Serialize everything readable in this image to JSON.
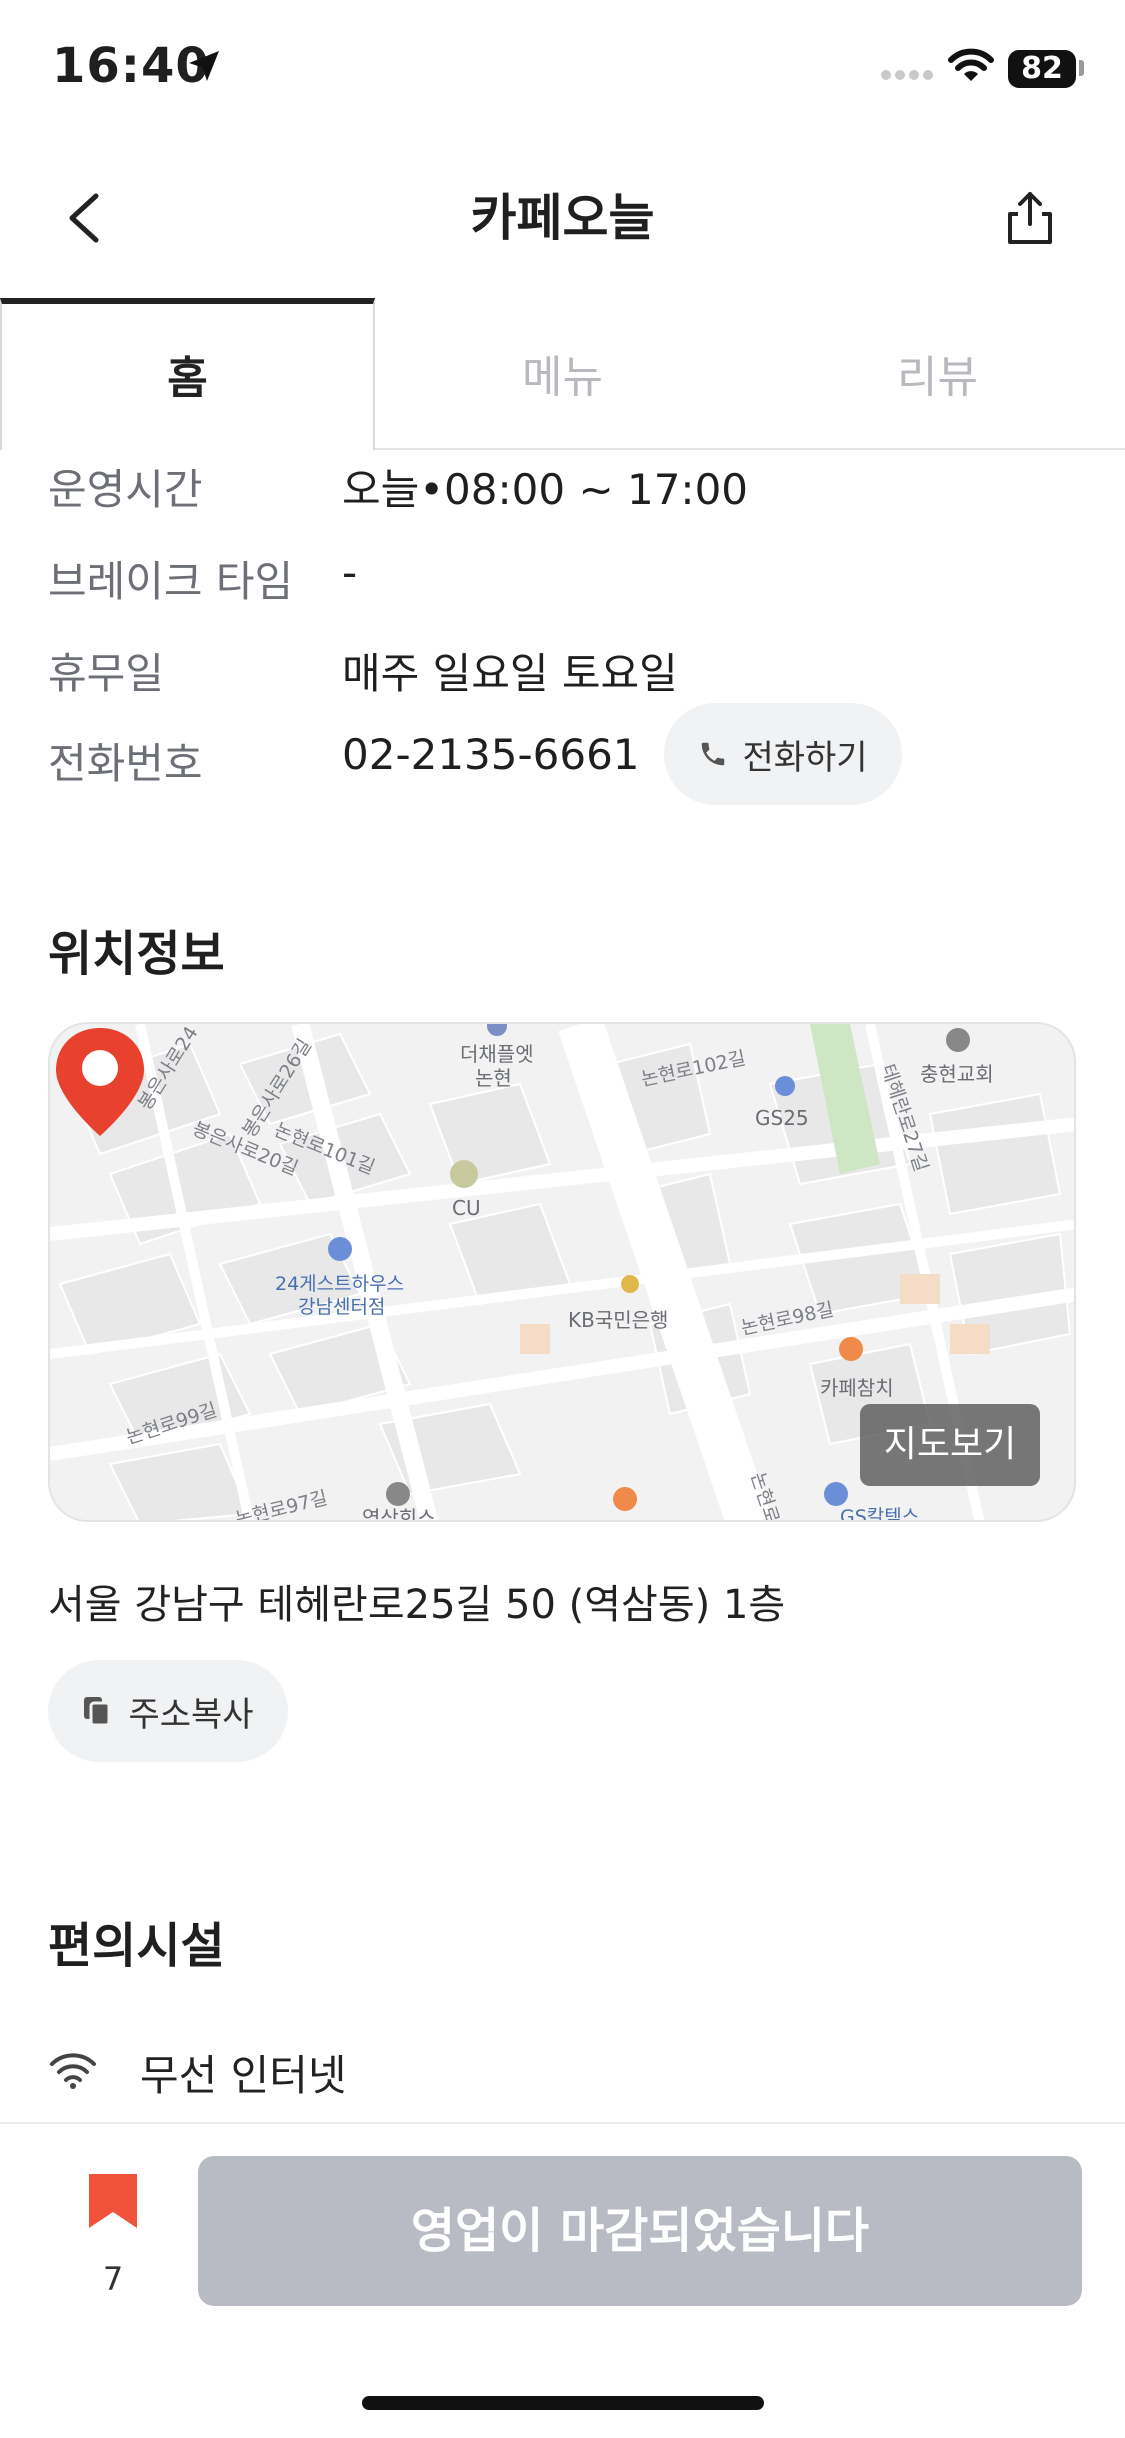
{
  "status_bar": {
    "time": "16:40",
    "battery": "82"
  },
  "header": {
    "title": "카페오늘"
  },
  "tabs": [
    {
      "label": "홈",
      "active": true
    },
    {
      "label": "메뉴",
      "active": false
    },
    {
      "label": "리뷰",
      "active": false
    }
  ],
  "info": {
    "hours": {
      "label": "운영시간",
      "value": "오늘•08:00 ~ 17:00"
    },
    "break": {
      "label": "브레이크 타임",
      "value": "-"
    },
    "closed_days": {
      "label": "휴무일",
      "value": "매주 일요일 토요일"
    },
    "phone": {
      "label": "전화번호",
      "value": "02-2135-6661",
      "call_label": "전화하기"
    }
  },
  "location": {
    "section_title": "위치정보",
    "map_button": "지도보기",
    "map_labels": {
      "l1": "더채플엣",
      "l2": "논현",
      "l3": "논현로102길",
      "l4": "GS25",
      "l5": "충현교회",
      "l6": "봉은사로24",
      "l7": "봉은사로26길",
      "l8": "봉은사로20길",
      "l9": "논현로101길",
      "l10": "CU",
      "l11": "24게스트하우스",
      "l12": "강남센터점",
      "l13": "KB국민은행",
      "l14": "논현로98길",
      "l15": "카페참치",
      "l16": "논현로99길",
      "l17": "논현로97길",
      "l18": "역삼회스",
      "l19": "테헤란로27길",
      "l20": "논현로",
      "l21": "GS칼텍스"
    },
    "address": "서울 강남구 테헤란로25길 50 (역삼동) 1층",
    "copy_label": "주소복사"
  },
  "facilities": {
    "section_title": "편의시설",
    "items": [
      {
        "icon": "wifi-icon",
        "label": "무선 인터넷"
      }
    ]
  },
  "bottom_bar": {
    "bookmark_count": "7",
    "status_button": "영업이 마감되었습니다"
  },
  "colors": {
    "accent": "#f0533a",
    "pin": "#e8412e",
    "disabled_button": "#b8bbc3"
  }
}
